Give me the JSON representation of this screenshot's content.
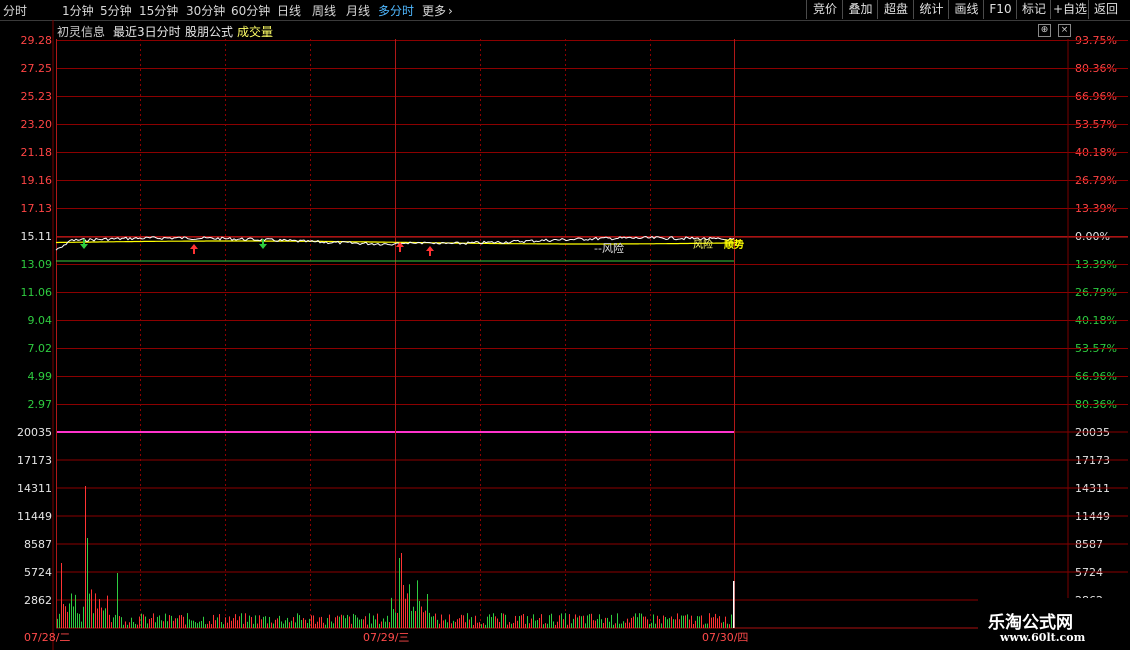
{
  "toolbar": {
    "periods": [
      "分时",
      "1分钟",
      "5分钟",
      "15分钟",
      "30分钟",
      "60分钟",
      "日线",
      "周线",
      "月线",
      "多分时",
      "更多"
    ],
    "active_period": "多分时",
    "more_arrow": "›",
    "right_buttons": [
      "竞价",
      "叠加",
      "超盘",
      "统计",
      "画线",
      "F10",
      "标记",
      "+自选",
      "返回"
    ]
  },
  "info": {
    "stock_name": "初灵信息",
    "period_label": "最近3日分时",
    "formula_name": "股朋公式",
    "volume_label": "成交量",
    "up_icon": "⊕",
    "close_icon": "×"
  },
  "price_axis": {
    "left": [
      "29.28",
      "27.25",
      "25.23",
      "23.20",
      "21.18",
      "19.16",
      "17.13",
      "15.11",
      "13.09",
      "11.06",
      "9.04",
      "7.02",
      "4.99",
      "2.97"
    ],
    "right": [
      "93.75%",
      "80.36%",
      "66.96%",
      "53.57%",
      "40.18%",
      "26.79%",
      "13.39%",
      "0.00%",
      "13.39%",
      "26.79%",
      "40.18%",
      "53.57%",
      "66.96%",
      "80.36%"
    ],
    "reference_price": 15.11
  },
  "volume_axis": {
    "labels": [
      "20035",
      "17173",
      "14311",
      "11449",
      "8587",
      "5724",
      "2862"
    ],
    "max": 20035
  },
  "dates": [
    "07/28/二",
    "07/29/三",
    "07/30/四"
  ],
  "markers": {
    "risk_label": "--风险",
    "end_label_a": "风险",
    "end_label_b": "顺势"
  },
  "colors": {
    "grid": "#8b0000",
    "price_line": "#ffffff",
    "avg_line": "#ffff00",
    "support_line": "#3ccc3c",
    "vol_divider": "#ff33cc",
    "up": "#ff3333",
    "down": "#2ecc40"
  },
  "watermark": {
    "name": "乐淘公式网",
    "url": "www.60lt.com"
  }
}
